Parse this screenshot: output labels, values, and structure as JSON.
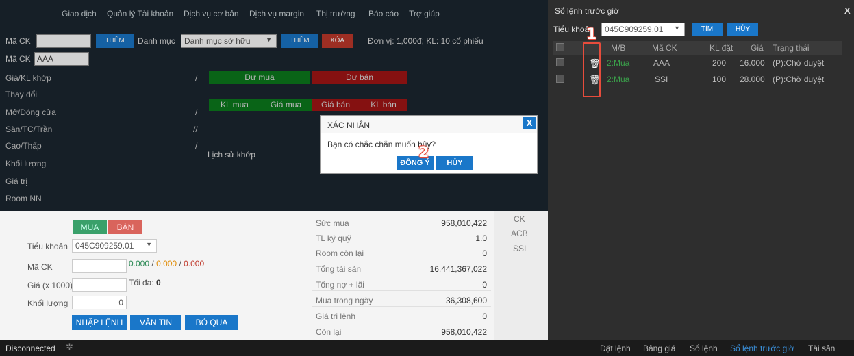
{
  "menu": [
    "Giao dịch",
    "Quản lý Tài khoản",
    "Dịch vụ cơ bản",
    "Dịch vụ margin",
    "Thị trường",
    "Báo cáo",
    "Trợ giúp"
  ],
  "toolbar": {
    "ma_ck_label": "Mã CK",
    "them_label": "THÊM",
    "danh_muc_label": "Danh mục",
    "danh_muc_value": "Danh mục sở hữu",
    "them2_label": "THÊM",
    "xoa_label": "XÓA",
    "unit_text": "Đơn vị: 1,000đ; KL: 10 cổ phiếu"
  },
  "quote": {
    "ma_ck_label": "Mã CK",
    "ma_ck_value": "AAA",
    "rows": [
      "Giá/KL khớp",
      "Thay đổi",
      "Mở/Đóng cửa",
      "Sàn/TC/Trần",
      "Cao/Thấp",
      "Khối lượng",
      "Giá trị",
      "Room NN"
    ],
    "slash1": "/",
    "slash2": "/",
    "slash3": "//",
    "slash4": "/",
    "du_mua": "Dư mua",
    "du_ban": "Dư bán",
    "kl_mua": "KL mua",
    "gia_mua": "Giá mua",
    "gia_ban": "Giá bán",
    "kl_ban": "KL bán",
    "lich_su": "Lịch sử khớp"
  },
  "dialog": {
    "title": "XÁC NHẬN",
    "message": "Bạn có chắc chắn muốn hủy?",
    "ok": "ĐỒNG Ý",
    "cancel": "HỦY",
    "close": "X"
  },
  "order": {
    "mua": "MUA",
    "ban": "BÁN",
    "tieu_khoan_label": "Tiểu khoản",
    "tieu_khoan_value": "045C909259.01",
    "ma_ck_label": "Mã CK",
    "price_green": "0.000",
    "price_orange": "0.000",
    "price_red": "0.000",
    "sep": "/",
    "gia_label": "Giá (x 1000)",
    "toi_da_label": "Tối đa:",
    "toi_da_value": "0",
    "kl_label": "Khối lượng",
    "kl_value": "0",
    "nhap": "NHẬP LỆNH",
    "van_tin": "VẤN TIN",
    "bo_qua": "BỎ QUA"
  },
  "info": [
    {
      "k": "Sức mua",
      "v": "958,010,422"
    },
    {
      "k": "TL ký quỹ",
      "v": "1.0"
    },
    {
      "k": "Room còn lại",
      "v": "0"
    },
    {
      "k": "Tổng tài sản",
      "v": "16,441,367,022"
    },
    {
      "k": "Tổng nợ + lãi",
      "v": "0"
    },
    {
      "k": "Mua trong ngày",
      "v": "36,308,600"
    },
    {
      "k": "Giá trị lệnh",
      "v": "0"
    },
    {
      "k": "Còn lại",
      "v": "958,010,422"
    }
  ],
  "ck_list": {
    "header": "CK",
    "items": [
      "ACB",
      "SSI"
    ]
  },
  "status": {
    "text": "Disconnected"
  },
  "right": {
    "title": "Sổ lệnh trước giờ",
    "close": "X",
    "tieu_khoan_label": "Tiểu khoản",
    "tieu_khoan_value": "045C909259.01",
    "tim": "TÌM",
    "huy": "HỦY",
    "headers": [
      "M/B",
      "Mã CK",
      "KL đặt",
      "Giá",
      "Trạng thái"
    ],
    "rows": [
      {
        "mb": "2:Mua",
        "ck": "AAA",
        "kl": "200",
        "gia": "16.000",
        "tt": "(P):Chờ duyệt"
      },
      {
        "mb": "2:Mua",
        "ck": "SSI",
        "kl": "100",
        "gia": "28.000",
        "tt": "(P):Chờ duyệt"
      }
    ],
    "annot1": "1",
    "annot2": "2"
  },
  "bottom_tabs": [
    "Đặt lệnh",
    "Bảng giá",
    "Sổ lệnh",
    "Sổ lệnh trước giờ",
    "Tài sản"
  ],
  "colors": {
    "accent": "#1a77c9",
    "green": "#0c7a1d",
    "red": "#a31515",
    "active_tab": "#3a8fd9",
    "annot": "#e74c3c"
  }
}
